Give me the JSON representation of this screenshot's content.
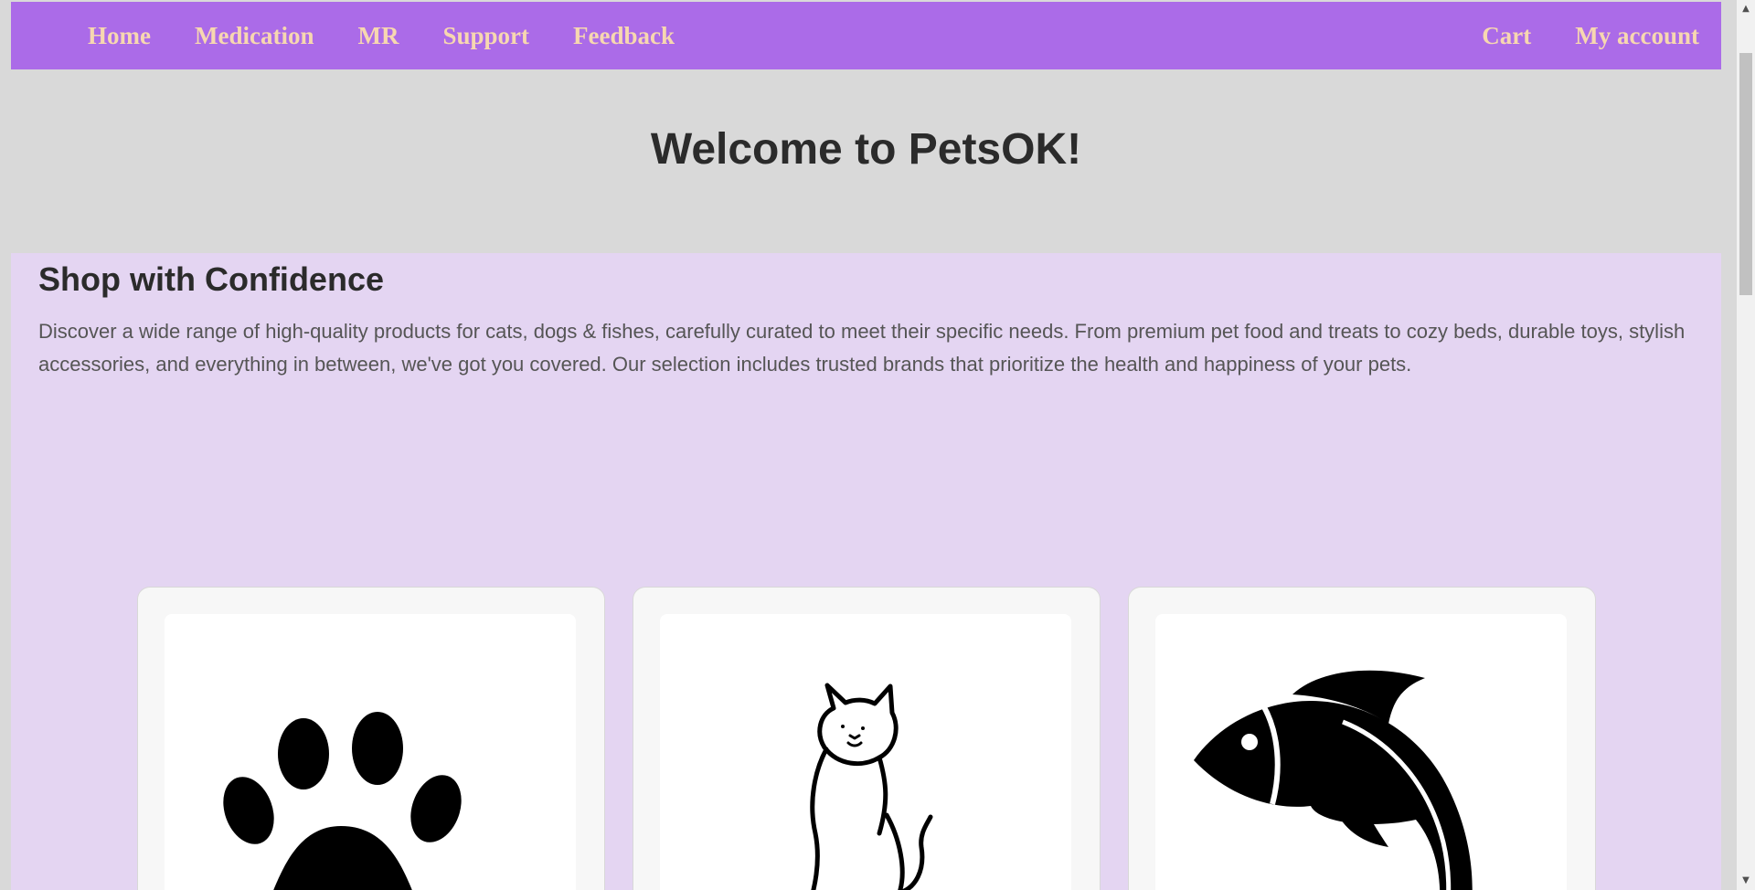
{
  "nav": {
    "left_items": [
      {
        "label": "Home"
      },
      {
        "label": "Medication"
      },
      {
        "label": "MR"
      },
      {
        "label": "Support"
      },
      {
        "label": "Feedback"
      }
    ],
    "right_items": [
      {
        "label": "Cart"
      },
      {
        "label": "My account"
      }
    ]
  },
  "hero": {
    "title": "Welcome to PetsOK!"
  },
  "shop": {
    "heading": "Shop with Confidence",
    "description": "Discover a wide range of high-quality products for cats, dogs & fishes, carefully curated to meet their specific needs. From premium pet food and treats to cozy beds, durable toys, stylish accessories, and everything in between, we've got you covered. Our selection includes trusted brands that prioritize the health and happiness of your pets."
  },
  "cards": [
    {
      "icon": "paw-print-icon"
    },
    {
      "icon": "cat-icon"
    },
    {
      "icon": "fish-icon"
    }
  ],
  "colors": {
    "nav_background": "#ab6be8",
    "nav_text": "#f7d7b0",
    "page_background": "#d9d9d9",
    "section_background": "#e4d5f2"
  }
}
